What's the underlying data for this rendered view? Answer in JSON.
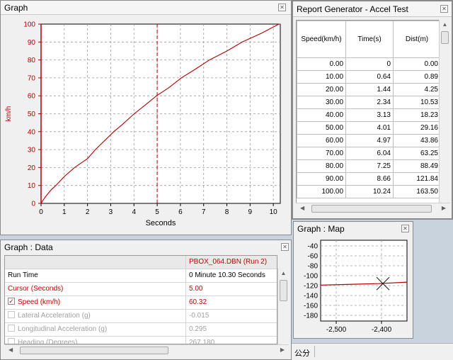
{
  "graph_panel": {
    "title": "Graph",
    "x_axis_label": "Seconds",
    "y_axis_label": "km/h",
    "line_color": "#b00000"
  },
  "chart_data": {
    "type": "line",
    "title": "",
    "xlabel": "Seconds",
    "ylabel": "km/h",
    "xlim": [
      0,
      10.3
    ],
    "ylim": [
      0,
      100
    ],
    "x_ticks": [
      "0",
      "1",
      "2",
      "3",
      "4",
      "5",
      "6",
      "7",
      "8",
      "9",
      "10"
    ],
    "y_ticks": [
      "0",
      "10",
      "20",
      "30",
      "40",
      "50",
      "60",
      "70",
      "80",
      "90",
      "100"
    ],
    "grid": true,
    "cursor_x": 5.0,
    "series": [
      {
        "x": [
          0,
          0.15,
          0.3,
          0.45,
          0.64,
          1.0,
          1.44,
          2.0,
          2.34,
          3.13,
          3.5,
          4.01,
          4.5,
          4.97,
          5.5,
          6.04,
          6.6,
          7.25,
          8.0,
          8.66,
          9.5,
          10.24,
          10.3
        ],
        "y": [
          0,
          3,
          5.5,
          7.8,
          10,
          15,
          20,
          25,
          30,
          40,
          44,
          50,
          55,
          60,
          64.5,
          70,
          74.5,
          80,
          85,
          90,
          95,
          100,
          100
        ]
      }
    ]
  },
  "report": {
    "title": "Report Generator - Accel Test",
    "headers": [
      "Speed(km/h)",
      "Time(s)",
      "Dist(m)"
    ],
    "rows": [
      [
        "0.00",
        "0",
        "0.00"
      ],
      [
        "10.00",
        "0.64",
        "0.89"
      ],
      [
        "20.00",
        "1.44",
        "4.25"
      ],
      [
        "30.00",
        "2.34",
        "10.53"
      ],
      [
        "40.00",
        "3.13",
        "18.23"
      ],
      [
        "50.00",
        "4.01",
        "29.16"
      ],
      [
        "60.00",
        "4.97",
        "43.86"
      ],
      [
        "70.00",
        "6.04",
        "63.25"
      ],
      [
        "80.00",
        "7.25",
        "88.49"
      ],
      [
        "90.00",
        "8.66",
        "121.84"
      ],
      [
        "100.00",
        "10.24",
        "163.50"
      ]
    ]
  },
  "map_panel": {
    "title": "Graph : Map",
    "y_ticks": [
      "-40",
      "-60",
      "-80",
      "-100",
      "-120",
      "-140",
      "-160",
      "-180"
    ],
    "x_ticks": [
      "-2,500",
      "-2,400"
    ]
  },
  "data_panel": {
    "title": "Graph : Data",
    "run_name": "PBOX_064.DBN (Run 2)",
    "rows": [
      {
        "label": "Run Time",
        "value": "0 Minute 10.30 Seconds"
      },
      {
        "label": "Cursor (Seconds)",
        "value": "5.00"
      },
      {
        "label": "Speed (km/h)",
        "value": "60.32"
      },
      {
        "label": "Lateral Acceleration (g)",
        "value": "-0.015"
      },
      {
        "label": "Longitudinal Acceleration (g)",
        "value": "0.295"
      },
      {
        "label": "Heading (Degrees)",
        "value": "267.180"
      }
    ]
  },
  "status_bar": {
    "text": "公分"
  },
  "icons": {
    "close": "close-icon",
    "check": "checkmark-icon"
  }
}
